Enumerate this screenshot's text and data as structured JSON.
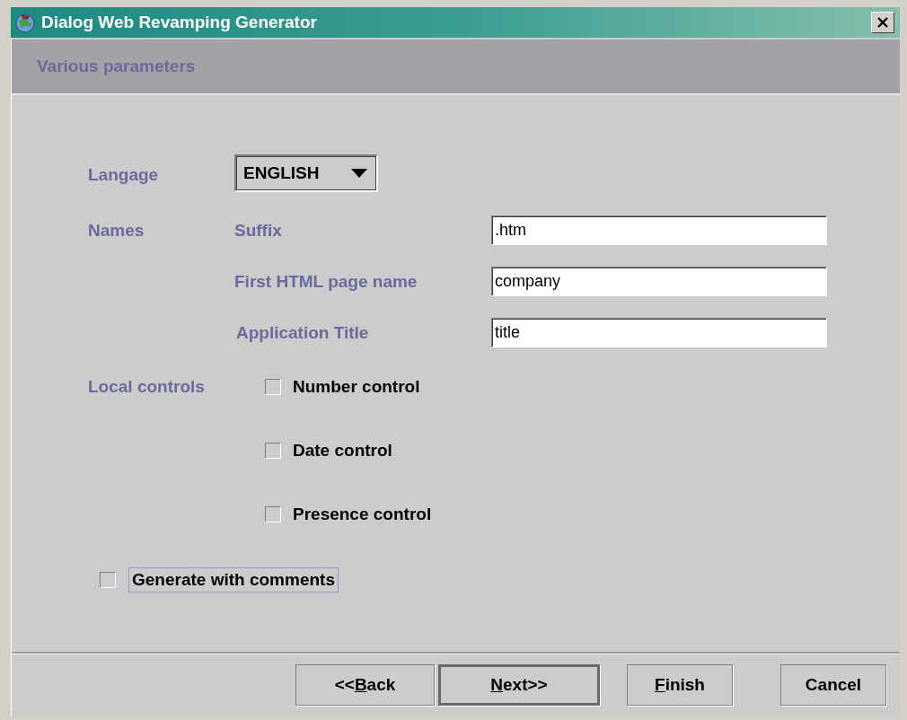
{
  "window": {
    "title": "Dialog Web Revamping Generator"
  },
  "header": {
    "title": "Various parameters"
  },
  "language": {
    "label": "Langage",
    "value": "ENGLISH"
  },
  "names": {
    "label": "Names",
    "fields": [
      {
        "label": "Suffix",
        "value": ".htm"
      },
      {
        "label": "First HTML page name",
        "value": "company"
      },
      {
        "label": "Application Title",
        "value": "title"
      }
    ]
  },
  "local_controls": {
    "label": "Local controls",
    "options": [
      {
        "label": "Number control",
        "checked": false
      },
      {
        "label": "Date control",
        "checked": false
      },
      {
        "label": "Presence control",
        "checked": false
      }
    ]
  },
  "generate_comments": {
    "label": "Generate with comments",
    "checked": false,
    "focused": true
  },
  "buttons": [
    {
      "before": "<<",
      "underlined": "B",
      "after": "ack",
      "default": false
    },
    {
      "underlined": "N",
      "after": "ext>>",
      "default": true
    },
    {
      "underlined": "F",
      "after": "inish",
      "default": false
    },
    {
      "before": "Cancel",
      "default": false
    }
  ]
}
